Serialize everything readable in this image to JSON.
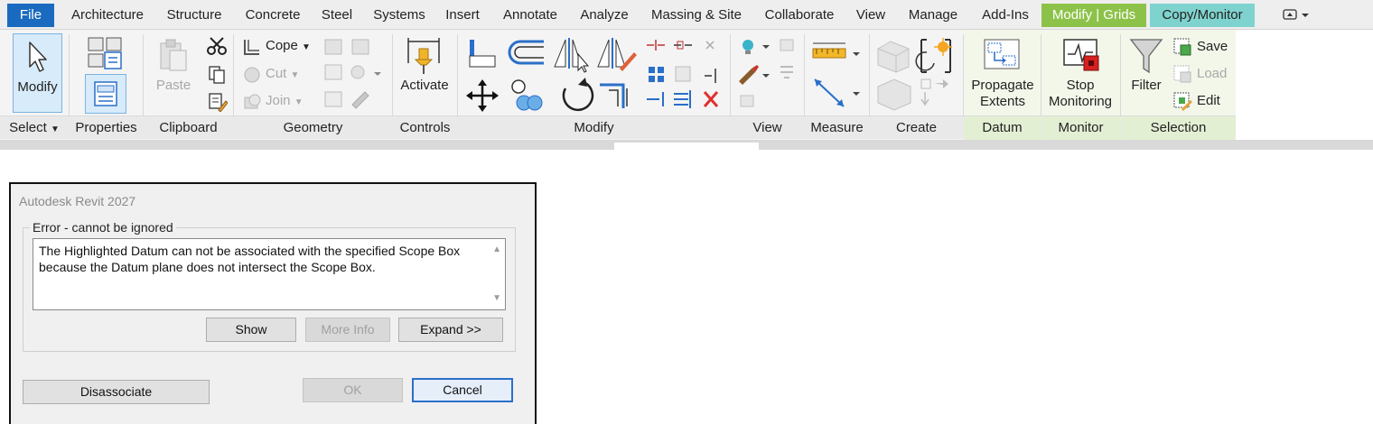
{
  "ribbon_tabs": [
    "File",
    "Architecture",
    "Structure",
    "Concrete",
    "Steel",
    "Systems",
    "Insert",
    "Annotate",
    "Analyze",
    "Massing & Site",
    "Collaborate",
    "View",
    "Manage",
    "Add-Ins",
    "Modify | Grids",
    "Copy/Monitor"
  ],
  "buttons": {
    "modify": "Modify",
    "paste": "Paste",
    "cope": "Cope",
    "cut": "Cut",
    "join": "Join",
    "activate": "Activate",
    "propagate_1": "Propagate",
    "propagate_2": "Extents",
    "stop_1": "Stop",
    "stop_2": "Monitoring",
    "filter": "Filter",
    "save": "Save",
    "load": "Load",
    "edit": "Edit"
  },
  "panels": [
    "Select",
    "Properties",
    "Clipboard",
    "Geometry",
    "Controls",
    "Modify",
    "View",
    "Measure",
    "Create",
    "Datum",
    "Monitor",
    "Selection"
  ],
  "dialog": {
    "title": "Autodesk Revit 2027",
    "group_label": "Error - cannot be ignored",
    "message": "The Highlighted Datum can not be associated with the specified Scope Box because the Datum plane does not intersect the Scope Box.",
    "show": "Show",
    "more_info": "More Info",
    "expand": "Expand >>",
    "disassociate": "Disassociate",
    "ok": "OK",
    "cancel": "Cancel"
  },
  "colors": {
    "file_tab": "#1a6bbf",
    "modify_grids_tab": "#8dc24a",
    "copy_monitor_tab": "#7fd3cf",
    "accent_blue": "#2a6fc9",
    "delete_red": "#e03030"
  }
}
